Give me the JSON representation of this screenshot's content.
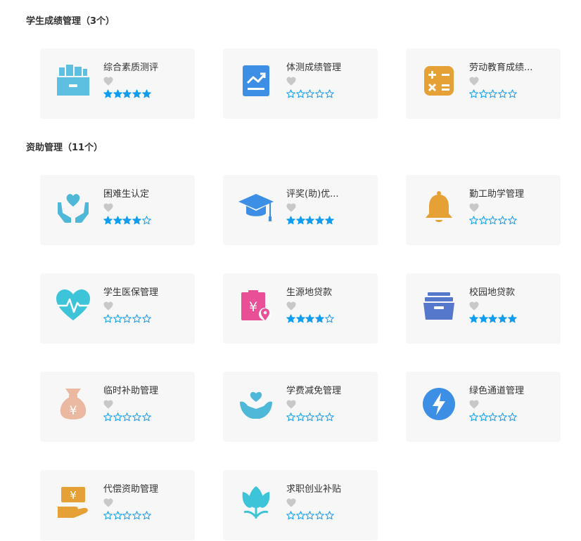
{
  "colors": {
    "star": "#0f9df0",
    "heart": "#c8c8c8",
    "card_bg": "#f7f7f7"
  },
  "sections": [
    {
      "title": "学生成绩管理（3个）",
      "cards": [
        {
          "name": "综合素质测评",
          "icon": "archive-box-icon",
          "rating": 5
        },
        {
          "name": "体测成绩管理",
          "icon": "trend-chart-icon",
          "rating": 0
        },
        {
          "name": "劳动教育成绩...",
          "icon": "calculator-icon",
          "rating": 0
        }
      ]
    },
    {
      "title": "资助管理（11个）",
      "cards": [
        {
          "name": "困难生认定",
          "icon": "hands-heart-icon",
          "rating": 4
        },
        {
          "name": "评奖(助)优...",
          "icon": "graduation-cap-icon",
          "rating": 5
        },
        {
          "name": "勤工助学管理",
          "icon": "bell-icon",
          "rating": 0
        },
        {
          "name": "学生医保管理",
          "icon": "heartbeat-icon",
          "rating": 0
        },
        {
          "name": "生源地贷款",
          "icon": "yuan-clipboard-icon",
          "rating": 4
        },
        {
          "name": "校园地贷款",
          "icon": "drawer-box-icon",
          "rating": 5
        },
        {
          "name": "临时补助管理",
          "icon": "money-bag-icon",
          "rating": 0
        },
        {
          "name": "学费减免管理",
          "icon": "hand-heart-icon",
          "rating": 0
        },
        {
          "name": "绿色通道管理",
          "icon": "lightning-icon",
          "rating": 0
        },
        {
          "name": "代偿资助管理",
          "icon": "hand-yuan-icon",
          "rating": 0
        },
        {
          "name": "求职创业补贴",
          "icon": "tulip-icon",
          "rating": 0
        }
      ]
    }
  ]
}
